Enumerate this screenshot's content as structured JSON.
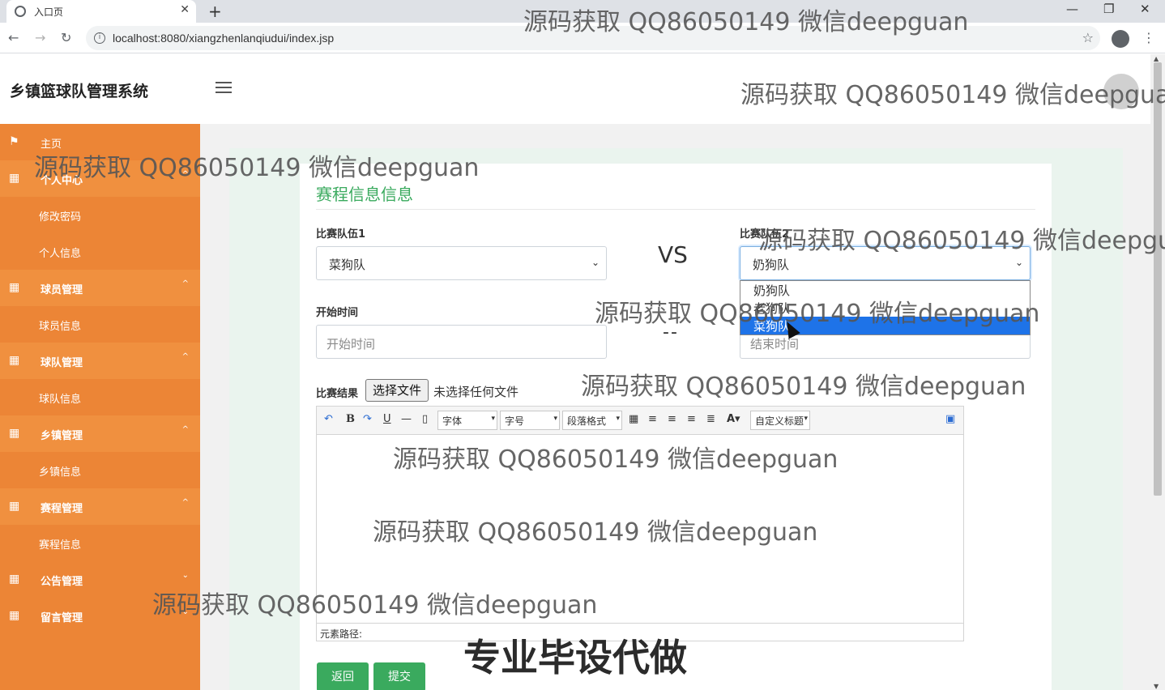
{
  "browser": {
    "tab_title": "入口页",
    "url": "localhost:8080/xiangzhenlanqiudui/index.jsp"
  },
  "header": {
    "brand": "乡镇篮球队管理系统"
  },
  "sidebar": {
    "items": [
      {
        "label": "主页",
        "type": "parent"
      },
      {
        "label": "个人中心",
        "type": "parent"
      },
      {
        "label": "修改密码",
        "type": "sub"
      },
      {
        "label": "个人信息",
        "type": "sub"
      },
      {
        "label": "球员管理",
        "type": "parent"
      },
      {
        "label": "球员信息",
        "type": "sub"
      },
      {
        "label": "球队管理",
        "type": "parent"
      },
      {
        "label": "球队信息",
        "type": "sub"
      },
      {
        "label": "乡镇管理",
        "type": "parent"
      },
      {
        "label": "乡镇信息",
        "type": "sub"
      },
      {
        "label": "赛程管理",
        "type": "parent"
      },
      {
        "label": "赛程信息",
        "type": "sub"
      },
      {
        "label": "公告管理",
        "type": "parent"
      },
      {
        "label": "留言管理",
        "type": "parent"
      }
    ]
  },
  "form": {
    "title": "赛程信息信息",
    "team1_label": "比赛队伍1",
    "team1_value": "菜狗队",
    "vs": "VS",
    "team2_label": "比赛队伍2",
    "team2_value": "奶狗队",
    "team2_options": [
      "奶狗队",
      "老狗队",
      "菜狗队"
    ],
    "team2_highlighted": "菜狗队",
    "start_label": "开始时间",
    "start_placeholder": "开始时间",
    "separator": "--",
    "end_placeholder": "结束时间",
    "result_label": "比赛结果",
    "file_button": "选择文件",
    "file_status": "未选择任何文件",
    "editor": {
      "font_family": "字体",
      "font_size": "字号",
      "paragraph": "段落格式",
      "custom_title": "自定义标题",
      "path_label": "元素路径:"
    },
    "back_button": "返回",
    "submit_button": "提交"
  },
  "watermarks": [
    "源码获取 QQ86050149 微信deepguan",
    "源码获取 QQ86050149 微信deepguan",
    "源码获取 QQ86050149 微信deepguan",
    "源码获取 QQ86050149 微信deepguan",
    "源码获取 QQ86050149 微信deepguan",
    "源码获取 QQ86050149 微信deepguan",
    "源码获取 QQ86050149 微信deepguan",
    "源码获取 QQ86050149 微信deepguan",
    "源码获取 QQ86050149 微信deepguan"
  ],
  "stamp_text": "专业毕设代做",
  "colors": {
    "sidebar": "#ec8536",
    "accent_green": "#3aaa5e",
    "selected_option": "#1e73e8"
  }
}
